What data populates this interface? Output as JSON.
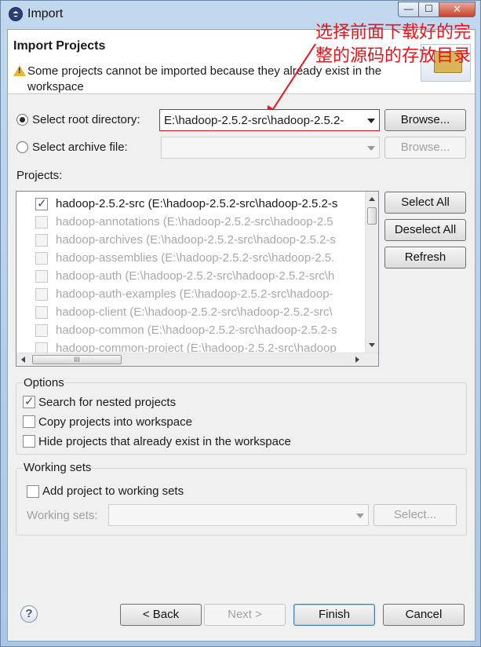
{
  "window": {
    "title": "Import",
    "controls": {
      "minimize": "—",
      "maximize": "☐",
      "close": "✕"
    }
  },
  "header": {
    "title": "Import Projects",
    "message": "Some projects cannot be imported because they already exist in the workspace",
    "annotation": "选择前面下载好的完整的源码的存放目录",
    "annotation_color": "#e8141b"
  },
  "source": {
    "root_dir_label": "Select root directory:",
    "root_dir_value": "E:\\hadoop-2.5.2-src\\hadoop-2.5.2-",
    "root_dir_selected": true,
    "archive_label": "Select archive file:",
    "archive_value": "",
    "browse_label": "Browse...",
    "browse_archive_label": "Browse..."
  },
  "projects": {
    "label": "Projects:",
    "items": [
      {
        "text": "hadoop-2.5.2-src (E:\\hadoop-2.5.2-src\\hadoop-2.5.2-s",
        "checked": true,
        "enabled": true
      },
      {
        "text": "hadoop-annotations (E:\\hadoop-2.5.2-src\\hadoop-2.5",
        "checked": false,
        "enabled": false
      },
      {
        "text": "hadoop-archives (E:\\hadoop-2.5.2-src\\hadoop-2.5.2-s",
        "checked": false,
        "enabled": false
      },
      {
        "text": "hadoop-assemblies (E:\\hadoop-2.5.2-src\\hadoop-2.5.",
        "checked": false,
        "enabled": false
      },
      {
        "text": "hadoop-auth (E:\\hadoop-2.5.2-src\\hadoop-2.5.2-src\\h",
        "checked": false,
        "enabled": false
      },
      {
        "text": "hadoop-auth-examples (E:\\hadoop-2.5.2-src\\hadoop-",
        "checked": false,
        "enabled": false
      },
      {
        "text": "hadoop-client (E:\\hadoop-2.5.2-src\\hadoop-2.5.2-src\\",
        "checked": false,
        "enabled": false
      },
      {
        "text": "hadoop-common (E:\\hadoop-2.5.2-src\\hadoop-2.5.2-s",
        "checked": false,
        "enabled": false
      },
      {
        "text": "hadoop-common-project (E:\\hadoop-2.5.2-src\\hadoop",
        "checked": false,
        "enabled": false
      }
    ],
    "select_all": "Select All",
    "deselect_all": "Deselect All",
    "refresh": "Refresh",
    "hscroll_grip": "III"
  },
  "options": {
    "title": "Options",
    "items": [
      {
        "label": "Search for nested projects",
        "checked": true
      },
      {
        "label": "Copy projects into workspace",
        "checked": false
      },
      {
        "label": "Hide projects that already exist in the workspace",
        "checked": false
      }
    ]
  },
  "working_sets": {
    "title": "Working sets",
    "add_label": "Add project to working sets",
    "add_checked": false,
    "sets_label": "Working sets:",
    "sets_value": "",
    "select_label": "Select..."
  },
  "footer": {
    "help": "?",
    "back": "< Back",
    "next": "Next >",
    "finish": "Finish",
    "cancel": "Cancel"
  }
}
